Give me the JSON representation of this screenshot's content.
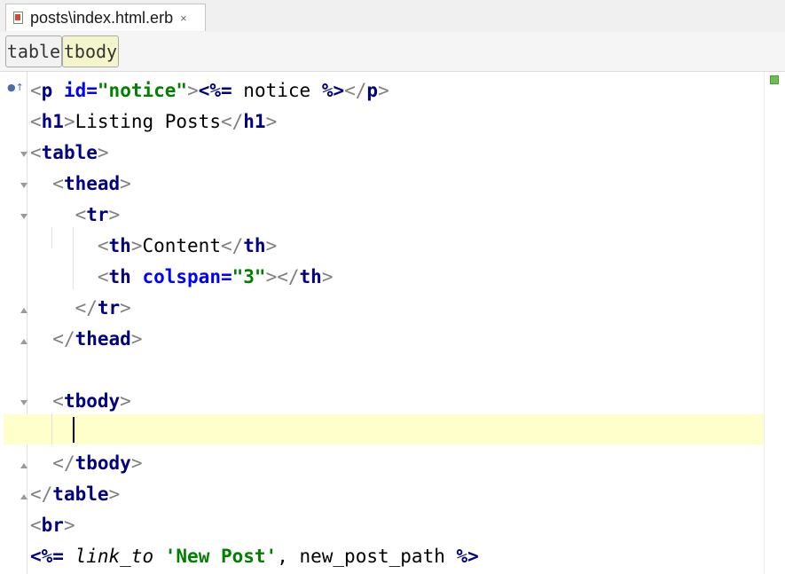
{
  "tab": {
    "title": "posts\\index.html.erb",
    "close": "×",
    "icon": "erb-file-icon"
  },
  "breadcrumb": [
    "table",
    "tbody"
  ],
  "colors": {
    "tag": "#000080",
    "attribute": "#0000ff",
    "string": "#008000",
    "current_line": "#ffffcc",
    "ok_marker": "#6cbf4f"
  },
  "lines": [
    {
      "tokens": [
        [
          "br",
          "<"
        ],
        [
          "tag",
          "p"
        ],
        [
          "code",
          " "
        ],
        [
          "attr",
          "id="
        ],
        [
          "str",
          "\"notice\""
        ],
        [
          "br",
          ">"
        ],
        [
          "erb",
          "<%="
        ],
        [
          "code",
          " notice "
        ],
        [
          "erb",
          "%>"
        ],
        [
          "br",
          "</"
        ],
        [
          "tag",
          "p"
        ],
        [
          "br",
          ">"
        ]
      ]
    },
    {
      "tokens": [
        [
          "br",
          "<"
        ],
        [
          "tag",
          "h1"
        ],
        [
          "br",
          ">"
        ],
        [
          "code",
          "Listing Posts"
        ],
        [
          "br",
          "</"
        ],
        [
          "tag",
          "h1"
        ],
        [
          "br",
          ">"
        ]
      ]
    },
    {
      "tokens": [
        [
          "br",
          "<"
        ],
        [
          "tag",
          "table"
        ],
        [
          "br",
          ">"
        ]
      ]
    },
    {
      "tokens": [
        [
          "code",
          "  "
        ],
        [
          "br",
          "<"
        ],
        [
          "tag",
          "thead"
        ],
        [
          "br",
          ">"
        ]
      ]
    },
    {
      "tokens": [
        [
          "code",
          "    "
        ],
        [
          "br",
          "<"
        ],
        [
          "tag",
          "tr"
        ],
        [
          "br",
          ">"
        ]
      ]
    },
    {
      "tokens": [
        [
          "code",
          "      "
        ],
        [
          "br",
          "<"
        ],
        [
          "tag",
          "th"
        ],
        [
          "br",
          ">"
        ],
        [
          "code",
          "Content"
        ],
        [
          "br",
          "</"
        ],
        [
          "tag",
          "th"
        ],
        [
          "br",
          ">"
        ]
      ]
    },
    {
      "tokens": [
        [
          "code",
          "      "
        ],
        [
          "br",
          "<"
        ],
        [
          "tag",
          "th"
        ],
        [
          "code",
          " "
        ],
        [
          "attr",
          "colspan="
        ],
        [
          "str",
          "\"3\""
        ],
        [
          "br",
          ">"
        ],
        [
          "br",
          "</"
        ],
        [
          "tag",
          "th"
        ],
        [
          "br",
          ">"
        ]
      ]
    },
    {
      "tokens": [
        [
          "code",
          "    "
        ],
        [
          "br",
          "</"
        ],
        [
          "tag",
          "tr"
        ],
        [
          "br",
          ">"
        ]
      ]
    },
    {
      "tokens": [
        [
          "code",
          "  "
        ],
        [
          "br",
          "</"
        ],
        [
          "tag",
          "thead"
        ],
        [
          "br",
          ">"
        ]
      ]
    },
    {
      "tokens": []
    },
    {
      "tokens": [
        [
          "code",
          "  "
        ],
        [
          "br",
          "<"
        ],
        [
          "tag",
          "tbody"
        ],
        [
          "br",
          ">"
        ]
      ]
    },
    {
      "tokens": []
    },
    {
      "tokens": [
        [
          "code",
          "  "
        ],
        [
          "br",
          "</"
        ],
        [
          "tag",
          "tbody"
        ],
        [
          "br",
          ">"
        ]
      ]
    },
    {
      "tokens": [
        [
          "br",
          "</"
        ],
        [
          "tag",
          "table"
        ],
        [
          "br",
          ">"
        ]
      ]
    },
    {
      "tokens": [
        [
          "br",
          "<"
        ],
        [
          "tag",
          "br"
        ],
        [
          "br",
          ">"
        ]
      ]
    },
    {
      "tokens": [
        [
          "erb",
          "<%="
        ],
        [
          "code",
          " "
        ],
        [
          "italic",
          "link_to"
        ],
        [
          "code",
          " "
        ],
        [
          "str",
          "'New Post'"
        ],
        [
          "code",
          ", new_post_path "
        ],
        [
          "erb",
          "%>"
        ]
      ]
    }
  ]
}
